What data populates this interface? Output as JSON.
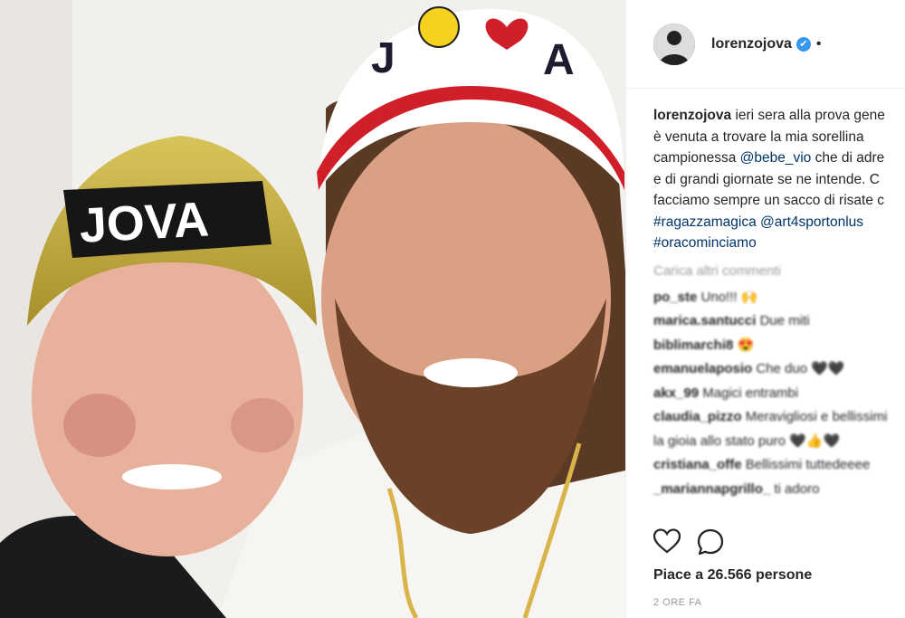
{
  "post": {
    "username": "lorenzojova",
    "verified_mark": "✔",
    "header_dot": "•",
    "caption": {
      "author": "lorenzojova",
      "line1": " ieri sera alla prova gene",
      "line2": "è venuta a trovare la mia sorellina",
      "line3a": "campionessa ",
      "mention1": "@bebe_vio",
      "line3b": " che di adre",
      "line4": "e di grandi giornate se ne intende. C",
      "line5": "facciamo sempre un sacco di risate c",
      "hashtag1": "#ragazzamagica",
      "mention2": "@art4sportonlus",
      "hashtag2": "#oracominciamo"
    },
    "load_more": "Carica altri commenti",
    "comments": [
      {
        "user": "po_ste",
        "text": "Uno!!! 🙌"
      },
      {
        "user": "marica.santucci",
        "text": "Due miti"
      },
      {
        "user": "biblimarchi8",
        "text": "😍"
      },
      {
        "user": "emanuelaposio",
        "text": "Che duo 🖤🖤"
      },
      {
        "user": "akx_99",
        "text": "Magici entrambi"
      },
      {
        "user": "claudia_pizzo",
        "text": "Meravigliosi e bellissimi"
      },
      {
        "user": "",
        "text": "la gioia allo stato puro 🖤👍🖤"
      },
      {
        "user": "cristiana_offe",
        "text": "Bellissimi tuttedeeee"
      },
      {
        "user": "_mariannapgrillo_",
        "text": "ti adoro"
      }
    ],
    "likes_label": "Piace a 26.566 persone",
    "time_label": "2 ORE FA",
    "icons": [
      "heart-icon",
      "comment-icon"
    ]
  },
  "photo": {
    "left_cap_text": "JOVA",
    "right_cap_letters": [
      "J",
      "A"
    ]
  }
}
